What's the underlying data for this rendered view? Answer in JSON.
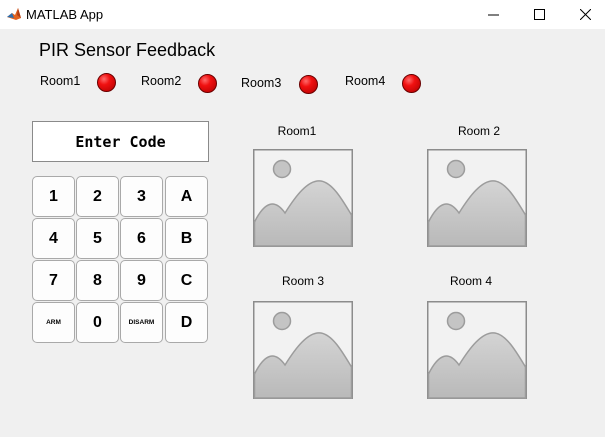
{
  "window": {
    "title": "MATLAB App",
    "icon": "matlab-logo-icon",
    "controls": [
      "minimize-icon",
      "maximize-icon",
      "close-icon"
    ]
  },
  "header": {
    "title": "PIR Sensor Feedback"
  },
  "sensors": [
    {
      "label": "Room1",
      "status": "red"
    },
    {
      "label": "Room2",
      "status": "red"
    },
    {
      "label": "Room3",
      "status": "red"
    },
    {
      "label": "Room4",
      "status": "red"
    }
  ],
  "colors": {
    "led_red": "#f01010",
    "background": "#f0f0f0",
    "image_placeholder": "#c8c8c8"
  },
  "code_display": {
    "text": "Enter Code"
  },
  "keypad": {
    "keys": [
      "1",
      "2",
      "3",
      "A",
      "4",
      "5",
      "6",
      "B",
      "7",
      "8",
      "9",
      "C",
      "ARM",
      "0",
      "DISARM",
      "D"
    ]
  },
  "cameras": [
    {
      "label": "Room1"
    },
    {
      "label": "Room 2"
    },
    {
      "label": "Room 3"
    },
    {
      "label": "Room 4"
    }
  ]
}
